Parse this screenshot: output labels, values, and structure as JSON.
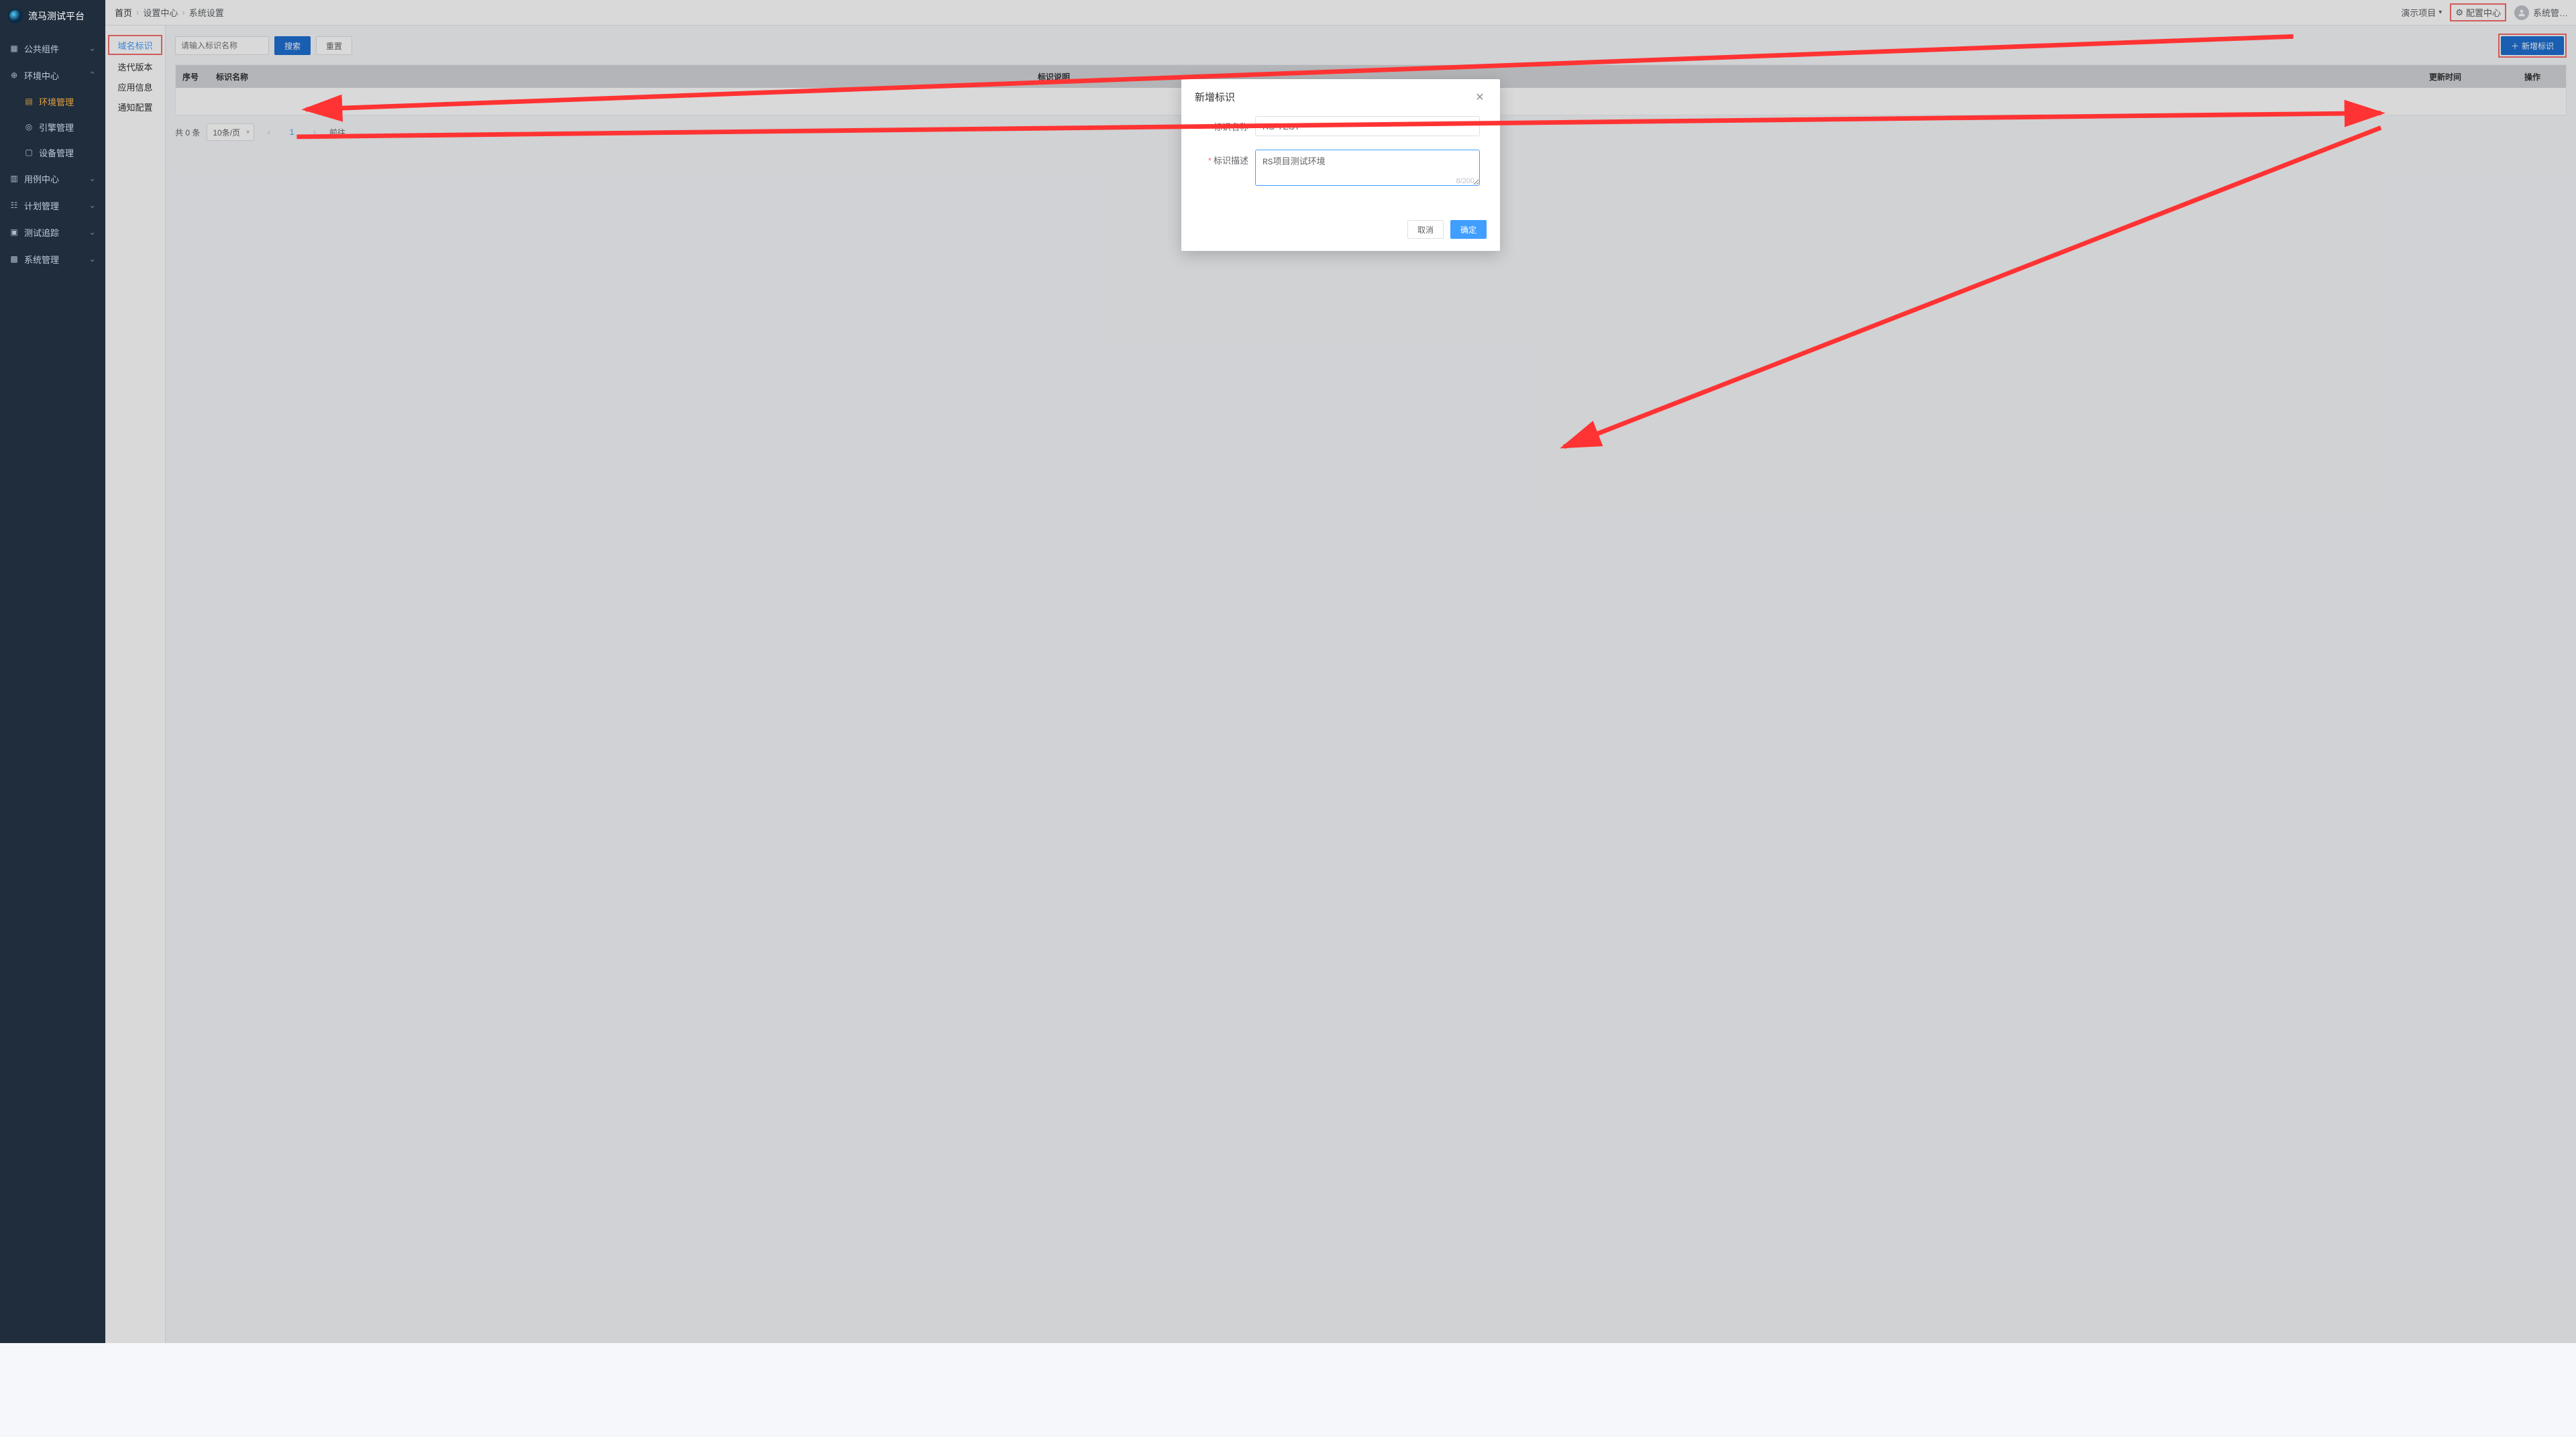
{
  "app_title": "流马测试平台",
  "sidebar": {
    "items": [
      {
        "label": "公共组件",
        "icon": "component-icon",
        "expandable": true
      },
      {
        "label": "环境中心",
        "icon": "globe-icon",
        "expandable": true,
        "expanded": true,
        "children": [
          {
            "label": "环境管理",
            "icon": "grid-icon",
            "active": true
          },
          {
            "label": "引擎管理",
            "icon": "target-icon"
          },
          {
            "label": "设备管理",
            "icon": "device-icon"
          }
        ]
      },
      {
        "label": "用例中心",
        "icon": "case-icon",
        "expandable": true
      },
      {
        "label": "计划管理",
        "icon": "calendar-icon",
        "expandable": true
      },
      {
        "label": "测试追踪",
        "icon": "track-icon",
        "expandable": true
      },
      {
        "label": "系统管理",
        "icon": "system-icon",
        "expandable": true
      }
    ]
  },
  "breadcrumb": {
    "home": "首页",
    "items": [
      "设置中心",
      "系统设置"
    ]
  },
  "header": {
    "project": "演示项目",
    "config_center": "配置中心",
    "user": "系统管…"
  },
  "left_tabs": [
    {
      "label": "域名标识",
      "active": true
    },
    {
      "label": "迭代版本"
    },
    {
      "label": "应用信息"
    },
    {
      "label": "通知配置"
    }
  ],
  "toolbar": {
    "search_placeholder": "请输入标识名称",
    "search": "搜索",
    "reset": "重置",
    "add": "新增标识"
  },
  "table": {
    "columns": {
      "idx": "序号",
      "name": "标识名称",
      "desc": "标识说明",
      "time": "更新时间",
      "op": "操作"
    },
    "rows": []
  },
  "pagination": {
    "total_label": "共 0 条",
    "page_size_label": "10条/页",
    "current": "1",
    "goto_label": "前往"
  },
  "dialog": {
    "title": "新增标识",
    "fields": {
      "name_label": "标识名称",
      "name_value": "RS-TEST",
      "desc_label": "标识描述",
      "desc_value": "RS项目测试环境",
      "counter": "8/200"
    },
    "cancel": "取消",
    "confirm": "确定"
  }
}
